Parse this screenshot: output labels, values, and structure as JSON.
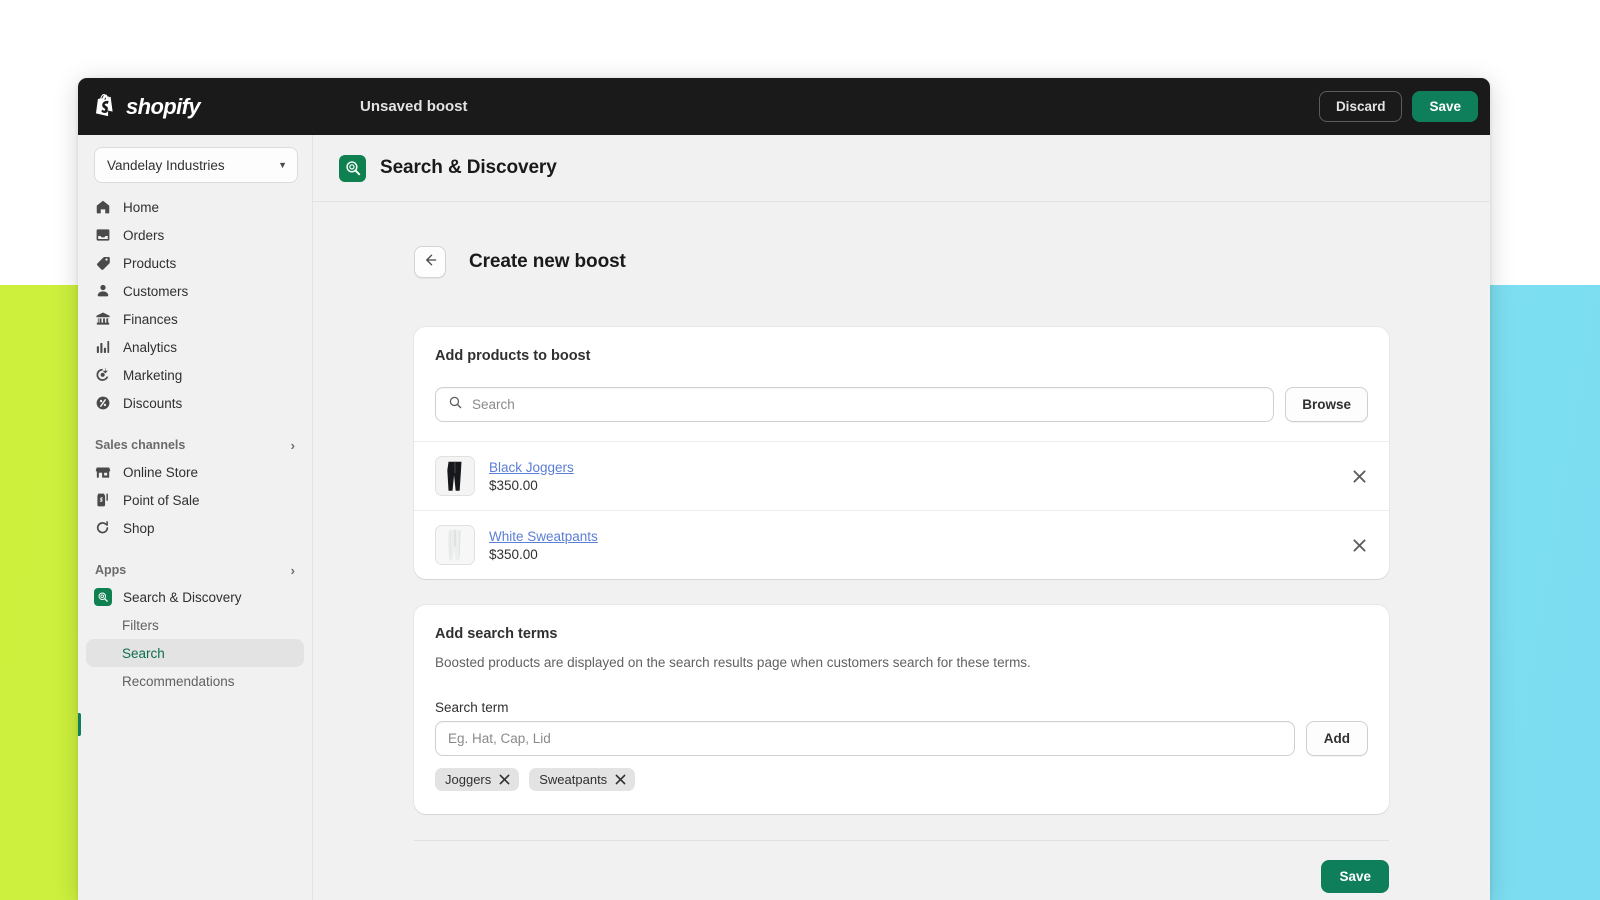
{
  "topbar": {
    "brand": "shopify",
    "title": "Unsaved boost",
    "discard_label": "Discard",
    "save_label": "Save"
  },
  "sidebar": {
    "store": "Vandelay Industries",
    "nav": [
      {
        "label": "Home",
        "icon": "home-icon"
      },
      {
        "label": "Orders",
        "icon": "orders-icon"
      },
      {
        "label": "Products",
        "icon": "products-tag-icon"
      },
      {
        "label": "Customers",
        "icon": "customers-person-icon"
      },
      {
        "label": "Finances",
        "icon": "finances-bank-icon"
      },
      {
        "label": "Analytics",
        "icon": "analytics-bars-icon"
      },
      {
        "label": "Marketing",
        "icon": "marketing-target-icon"
      },
      {
        "label": "Discounts",
        "icon": "discounts-percent-icon"
      }
    ],
    "sales_channels_header": "Sales channels",
    "sales_channels": [
      {
        "label": "Online Store",
        "icon": "online-store-icon"
      },
      {
        "label": "Point of Sale",
        "icon": "point-of-sale-icon"
      },
      {
        "label": "Shop",
        "icon": "shop-icon"
      }
    ],
    "apps_header": "Apps",
    "app_name": "Search & Discovery",
    "app_subitems": [
      {
        "label": "Filters",
        "selected": false
      },
      {
        "label": "Search",
        "selected": true
      },
      {
        "label": "Recommendations",
        "selected": false
      }
    ]
  },
  "page": {
    "app_title": "Search & Discovery",
    "heading": "Create new boost",
    "back_icon": "arrow-left-icon"
  },
  "products_card": {
    "title": "Add products to boost",
    "search_placeholder": "Search",
    "search_value": "",
    "browse_label": "Browse",
    "items": [
      {
        "name": "Black Joggers",
        "price": "$350.00",
        "thumb": "black-joggers-thumb"
      },
      {
        "name": "White Sweatpants",
        "price": "$350.00",
        "thumb": "white-sweatpants-thumb"
      }
    ]
  },
  "terms_card": {
    "title": "Add search terms",
    "description": "Boosted products are displayed on the search results page when customers search for these terms.",
    "field_label": "Search term",
    "input_placeholder": "Eg. Hat, Cap, Lid",
    "input_value": "",
    "add_label": "Add",
    "tags": [
      "Joggers",
      "Sweatpants"
    ]
  },
  "footer": {
    "save_label": "Save"
  },
  "colors": {
    "brand_green": "#0f7e5b",
    "app_icon_green": "#0f8050",
    "topbar_black": "#1a1a1a",
    "link_blue": "#5b7ed6",
    "selected_green_text": "#0d6e4f"
  }
}
